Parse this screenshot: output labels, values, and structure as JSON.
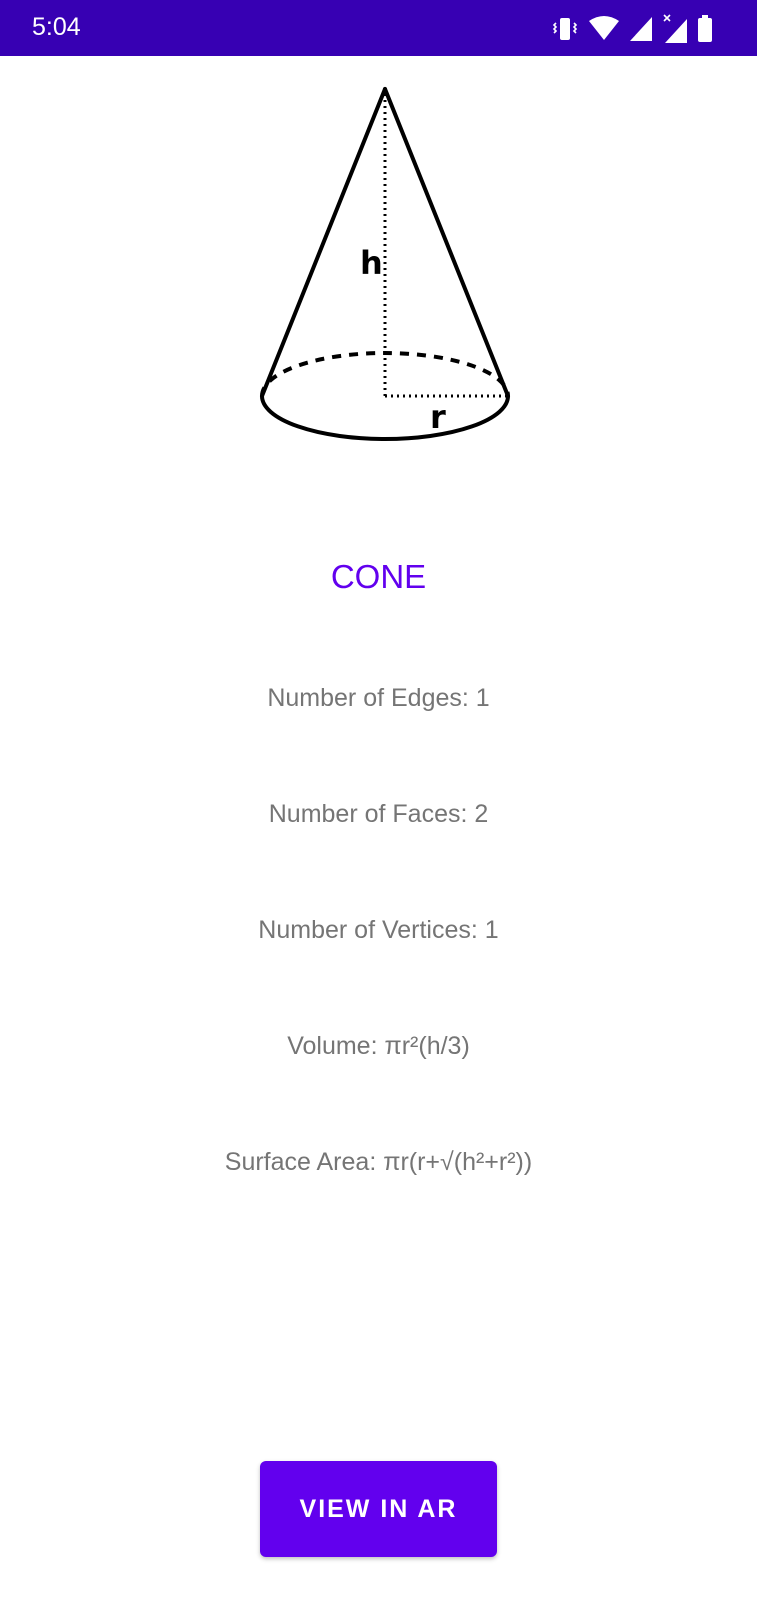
{
  "status_bar": {
    "time": "5:04",
    "icons": [
      "vibrate-icon",
      "wifi-icon",
      "signal-icon",
      "signal-no-data-icon",
      "battery-icon"
    ],
    "background_color": "#3700b3"
  },
  "diagram": {
    "height_label": "h",
    "radius_label": "r"
  },
  "shape": {
    "name": "CONE",
    "accent_color": "#6200ee"
  },
  "properties": {
    "edges": "Number of Edges: 1",
    "faces": "Number of Faces: 2",
    "vertices": "Number of Vertices: 1",
    "volume": "Volume: πr²(h/3)",
    "surface_area": "Surface Area: πr(r+√(h²+r²))"
  },
  "actions": {
    "view_ar_label": "VIEW IN AR"
  }
}
